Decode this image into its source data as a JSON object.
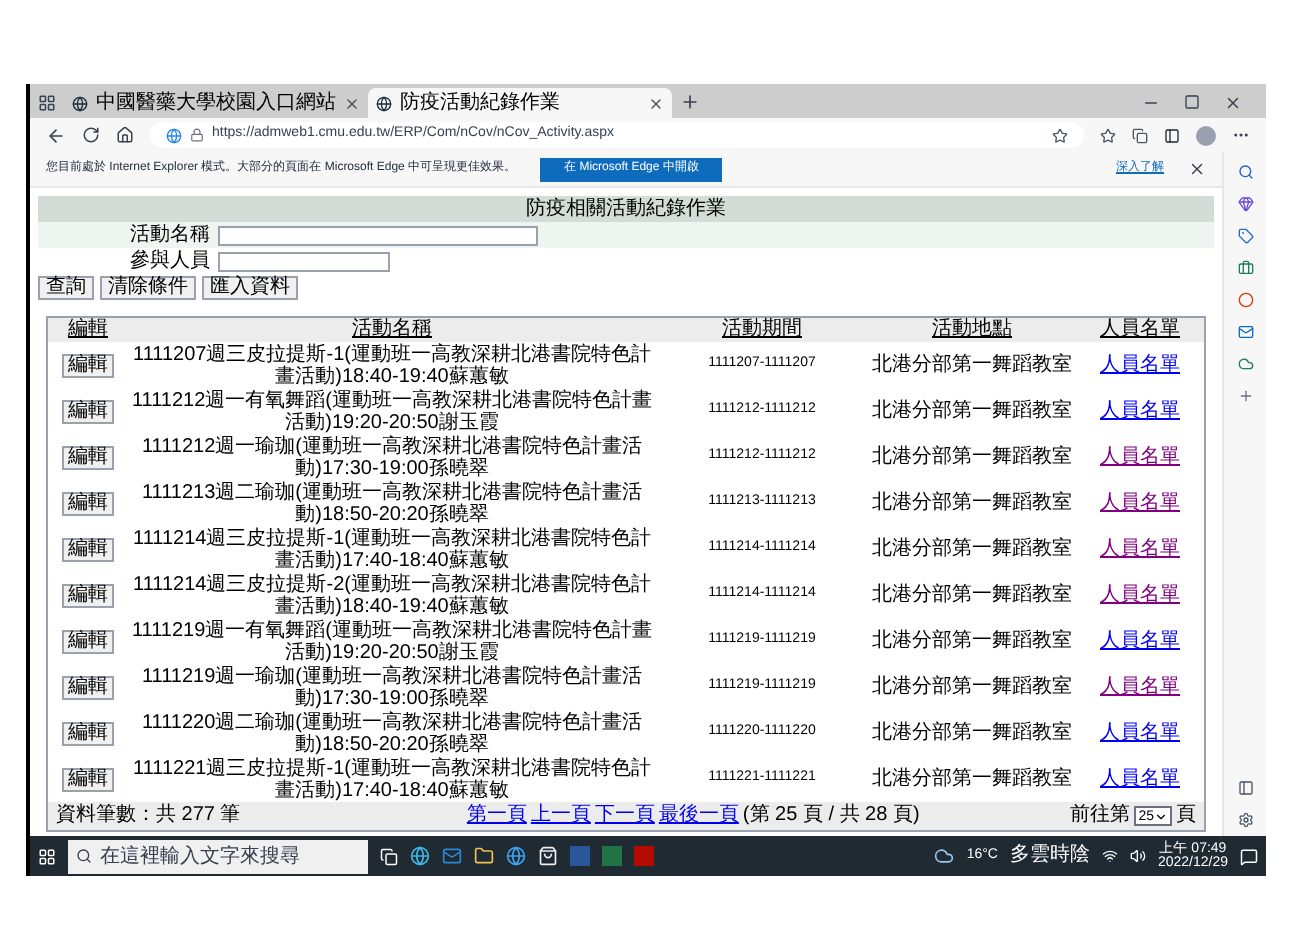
{
  "browser": {
    "tabs": [
      {
        "title": "中國醫藥大學校園入口網站",
        "selected": false
      },
      {
        "title": "防疫活動紀錄作業",
        "selected": true
      }
    ],
    "address": "https://admweb1.cmu.edu.tw/ERP/Com/nCov/nCov_Activity.aspx",
    "infobar": {
      "message": "您目前處於 Internet Explorer 模式。大部分的頁面在 Microsoft Edge 中可呈現更佳效果。",
      "button": "在 Microsoft Edge 中開啟",
      "link": "深入了解"
    }
  },
  "page": {
    "title": "防疫相關活動紀錄作業",
    "fields": [
      {
        "label": "活動名稱",
        "kind": "wide"
      },
      {
        "label": "參與人員",
        "kind": "narrow"
      }
    ],
    "buttons": [
      "查詢",
      "清除條件",
      "匯入資料"
    ],
    "table": {
      "columns": [
        "編輯",
        "活動名稱",
        "活動期間",
        "活動地點",
        "人員名單"
      ],
      "rows": [
        {
          "edit": "編輯",
          "name": "1111207週三皮拉提斯-1(運動班一高教深耕北港書院特色計畫活動)18:40-19:40蘇蕙敏",
          "period": "1111207-1111207",
          "location": "北港分部第一舞蹈教室",
          "members": "人員名單",
          "visited": false
        },
        {
          "edit": "編輯",
          "name": "1111212週一有氧舞蹈(運動班一高教深耕北港書院特色計畫活動)19:20-20:50謝玉霞",
          "period": "1111212-1111212",
          "location": "北港分部第一舞蹈教室",
          "members": "人員名單",
          "visited": false
        },
        {
          "edit": "編輯",
          "name": "1111212週一瑜珈(運動班一高教深耕北港書院特色計畫活動)17:30-19:00孫曉翠",
          "period": "1111212-1111212",
          "location": "北港分部第一舞蹈教室",
          "members": "人員名單",
          "visited": true
        },
        {
          "edit": "編輯",
          "name": "1111213週二瑜珈(運動班一高教深耕北港書院特色計畫活動)18:50-20:20孫曉翠",
          "period": "1111213-1111213",
          "location": "北港分部第一舞蹈教室",
          "members": "人員名單",
          "visited": true
        },
        {
          "edit": "編輯",
          "name": "1111214週三皮拉提斯-1(運動班一高教深耕北港書院特色計畫活動)17:40-18:40蘇蕙敏",
          "period": "1111214-1111214",
          "location": "北港分部第一舞蹈教室",
          "members": "人員名單",
          "visited": true
        },
        {
          "edit": "編輯",
          "name": "1111214週三皮拉提斯-2(運動班一高教深耕北港書院特色計畫活動)18:40-19:40蘇蕙敏",
          "period": "1111214-1111214",
          "location": "北港分部第一舞蹈教室",
          "members": "人員名單",
          "visited": true
        },
        {
          "edit": "編輯",
          "name": "1111219週一有氧舞蹈(運動班一高教深耕北港書院特色計畫活動)19:20-20:50謝玉霞",
          "period": "1111219-1111219",
          "location": "北港分部第一舞蹈教室",
          "members": "人員名單",
          "visited": false
        },
        {
          "edit": "編輯",
          "name": "1111219週一瑜珈(運動班一高教深耕北港書院特色計畫活動)17:30-19:00孫曉翠",
          "period": "1111219-1111219",
          "location": "北港分部第一舞蹈教室",
          "members": "人員名單",
          "visited": true
        },
        {
          "edit": "編輯",
          "name": "1111220週二瑜珈(運動班一高教深耕北港書院特色計畫活動)18:50-20:20孫曉翠",
          "period": "1111220-1111220",
          "location": "北港分部第一舞蹈教室",
          "members": "人員名單",
          "visited": false
        },
        {
          "edit": "編輯",
          "name": "1111221週三皮拉提斯-1(運動班一高教深耕北港書院特色計畫活動)17:40-18:40蘇蕙敏",
          "period": "1111221-1111221",
          "location": "北港分部第一舞蹈教室",
          "members": "人員名單",
          "visited": false
        }
      ]
    },
    "footer": {
      "count": "資料筆數：共 277 筆",
      "pager_links": [
        "第一頁",
        "上一頁",
        "下一頁",
        "最後一頁"
      ],
      "page_info": "(第 25 頁 / 共 28 頁)",
      "goto_label": "前往第",
      "goto_value": "25",
      "goto_suffix": "頁"
    }
  },
  "taskbar": {
    "search_placeholder": "在這裡輸入文字來搜尋",
    "temperature": "16°C",
    "weather": "多雲時陰",
    "time": "上午 07:49",
    "date": "2022/12/29"
  }
}
